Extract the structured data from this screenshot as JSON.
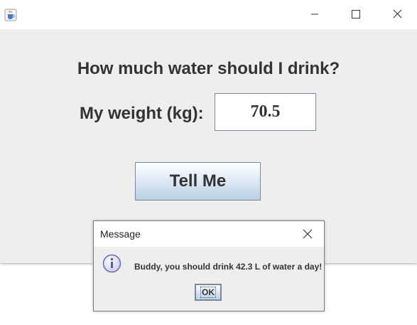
{
  "window": {
    "icon": "java-cup-icon",
    "controls": [
      "minimize-icon",
      "maximize-icon",
      "close-icon"
    ]
  },
  "main": {
    "prompt": "How much water should I drink?",
    "weight_label": "My weight (kg):",
    "weight_value": "70.5",
    "button_label": "Tell Me"
  },
  "dialog": {
    "title": "Message",
    "icon": "info-icon",
    "message": "Buddy, you should drink 42.3 L of water a day!",
    "ok_label": "OK"
  },
  "colors": {
    "window_bg": "#eeeeee",
    "text": "#333333",
    "button_gradient_bottom": "#b8cfe5",
    "info_icon": "#6a6ab3"
  }
}
